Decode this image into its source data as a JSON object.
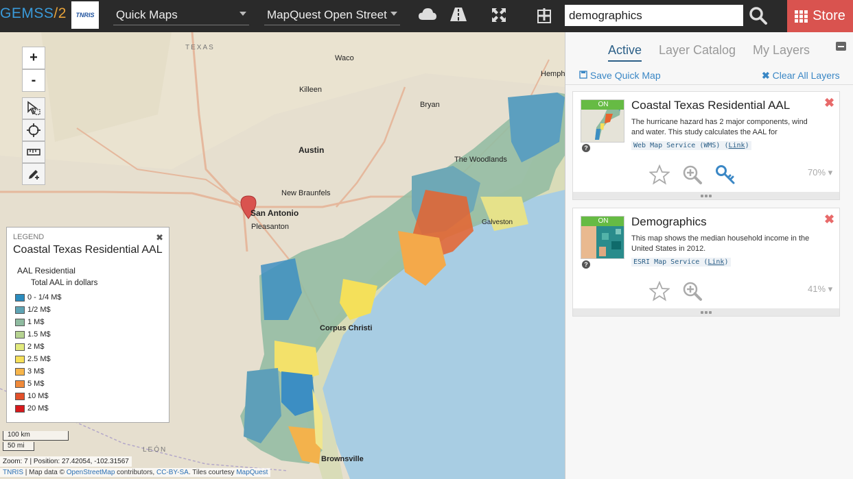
{
  "topbar": {
    "brand_left": "GEMSS",
    "brand_slash": "/",
    "brand_right": "2",
    "logo_text": "TNRIS",
    "quick_maps": "Quick Maps",
    "basemap": "MapQuest Open Street",
    "search_value": "demographics",
    "store_label": "Store"
  },
  "map": {
    "zoom_in": "+",
    "zoom_out": "-",
    "city_labels": [
      "TEXAS",
      "Waco",
      "Bryan",
      "Killeen",
      "Austin",
      "The Woodlands",
      "New Braunfels",
      "San Antonio",
      "Pleasanton",
      "Galveston",
      "Corpus Christi",
      "LEÓN",
      "Brownsville",
      "Hemphi"
    ],
    "legend": {
      "head": "LEGEND",
      "title": "Coastal Texas Residential AAL",
      "layer": "AAL Residential",
      "field": "Total AAL in dollars",
      "items": [
        {
          "label": "0 - 1/4 M$",
          "color": "#2b8cbe"
        },
        {
          "label": "1/2 M$",
          "color": "#5fa4b4"
        },
        {
          "label": "1 M$",
          "color": "#8fbba0"
        },
        {
          "label": "1.5 M$",
          "color": "#b6d391"
        },
        {
          "label": "2 M$",
          "color": "#e2ea7e"
        },
        {
          "label": "2.5 M$",
          "color": "#f6e05a"
        },
        {
          "label": "3 M$",
          "color": "#f7b54a"
        },
        {
          "label": "5 M$",
          "color": "#f08a3a"
        },
        {
          "label": "10 M$",
          "color": "#e2502a"
        },
        {
          "label": "20 M$",
          "color": "#d7191c"
        }
      ]
    },
    "scale_km": "100 km",
    "scale_mi": "50 mi",
    "status": "Zoom: 7 | Position: 27.42054, -102.31567",
    "attrib_tnris": "TNRIS",
    "attrib_1": " | Map data © ",
    "attrib_osm": "OpenStreetMap",
    "attrib_2": " contributors, ",
    "attrib_cc": "CC-BY-SA",
    "attrib_3": ". Tiles courtesy ",
    "attrib_mq": "MapQuest"
  },
  "panel": {
    "tabs": [
      "Active",
      "Layer Catalog",
      "My Layers"
    ],
    "save_quick_map": "Save Quick Map",
    "clear_all": "Clear All Layers",
    "layers": [
      {
        "on": "ON",
        "title": "Coastal Texas Residential AAL",
        "desc": "The hurricane hazard has 2 major components, wind and water. This study calculates the AAL for",
        "service": "Web Map Service (WMS) (",
        "link": "Link",
        "close": ")",
        "opacity": "70%"
      },
      {
        "on": "ON",
        "title": "Demographics",
        "desc": "This map shows the median household income in the United States in 2012.",
        "service": "ESRI Map Service (",
        "link": "Link",
        "close": ")",
        "opacity": "41%"
      }
    ]
  }
}
